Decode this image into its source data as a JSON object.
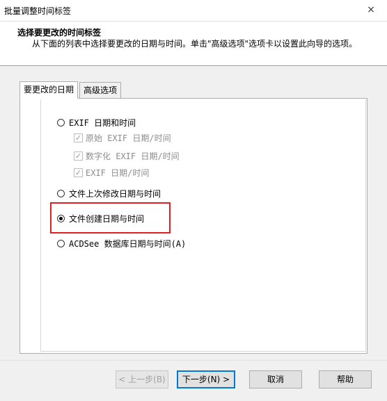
{
  "window": {
    "title": "批量调整时间标签",
    "close_icon": "×"
  },
  "header": {
    "title": "选择要更改的时间标签",
    "description": "从下面的列表中选择要更改的日期与时间。单击\"高级选项\"选项卡以设置此向导的选项。"
  },
  "tabs": [
    {
      "label": "要更改的日期",
      "active": true
    },
    {
      "label": "高级选项",
      "active": false
    }
  ],
  "options": {
    "exif": {
      "label": "EXIF 日期和时间",
      "selected": false
    },
    "exif_sub": [
      {
        "label": "原始 EXIF 日期/时间",
        "checked": true
      },
      {
        "label": "数字化 EXIF 日期/时间",
        "checked": true
      },
      {
        "label": "EXIF 日期/时间",
        "checked": true
      }
    ],
    "modified": {
      "label": "文件上次修改日期与时间",
      "selected": false
    },
    "created": {
      "label": "文件创建日期与时间",
      "selected": true
    },
    "acdsee": {
      "label": "ACDSee 数据库日期与时间(A)",
      "selected": false
    }
  },
  "buttons": {
    "back": "< 上一步(B)",
    "next": "下一步(N) >",
    "cancel": "取消",
    "help": "帮助"
  },
  "colors": {
    "highlight": "#e02020",
    "focus": "#0078d7"
  }
}
